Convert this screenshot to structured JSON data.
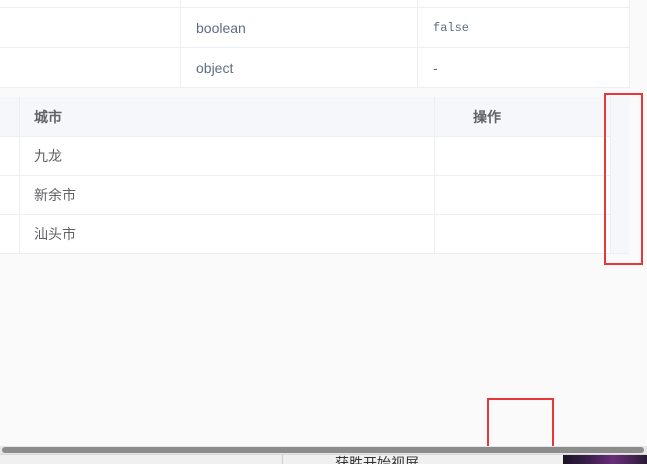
{
  "props_table": {
    "rows": [
      {
        "col1": "",
        "type": "",
        "default": ""
      },
      {
        "col1": "",
        "type": "boolean",
        "default": "false"
      },
      {
        "col1": "",
        "type": "object",
        "default": "-"
      }
    ]
  },
  "demo_table": {
    "headers": {
      "first": "",
      "city": "城市",
      "ops": "操作"
    },
    "rows": [
      {
        "city": "九龙",
        "ops": ""
      },
      {
        "city": "新余市",
        "ops": ""
      },
      {
        "city": "汕头市",
        "ops": ""
      }
    ]
  },
  "footer": {
    "button_label": "获胜开始视屏"
  },
  "colors": {
    "highlight": "#e8373b",
    "header_bg": "#f5f7fa",
    "border": "#ebeef5"
  }
}
